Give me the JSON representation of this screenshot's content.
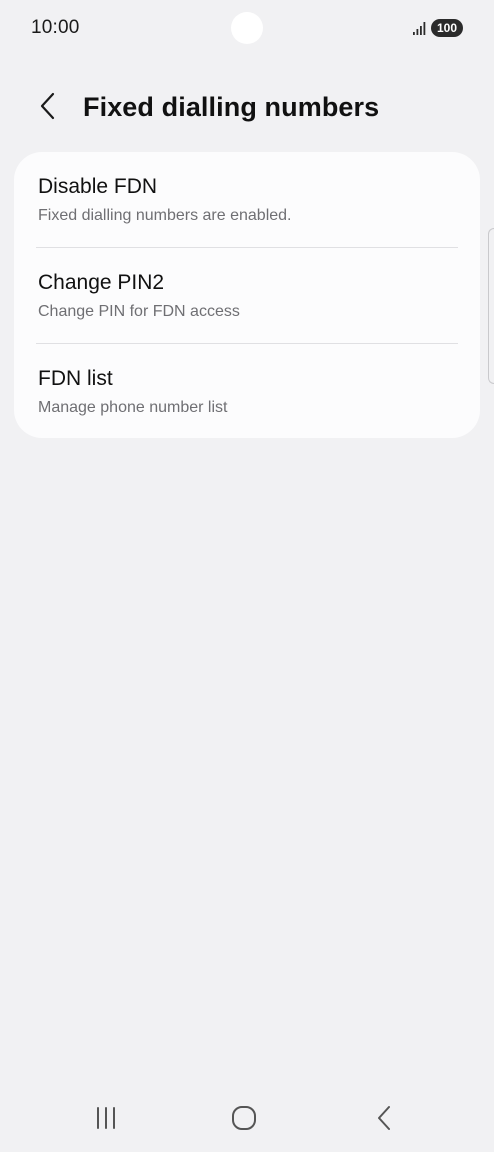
{
  "status_bar": {
    "time": "10:00",
    "battery": "100",
    "signal_icon": "signal-bars-icon"
  },
  "header": {
    "title": "Fixed dialling numbers",
    "back_icon": "chevron-left-icon"
  },
  "settings": {
    "items": [
      {
        "title": "Disable FDN",
        "subtitle": "Fixed dialling numbers are enabled."
      },
      {
        "title": "Change PIN2",
        "subtitle": "Change PIN for FDN access"
      },
      {
        "title": "FDN list",
        "subtitle": "Manage phone number list"
      }
    ]
  },
  "nav_bar": {
    "recents_icon": "recent-apps-icon",
    "home_icon": "home-icon",
    "back_icon": "back-icon"
  },
  "colors": {
    "background": "#f1f1f3",
    "card": "#fcfcfd",
    "subtitle": "#6f6f73",
    "divider": "#e0e0e3"
  }
}
